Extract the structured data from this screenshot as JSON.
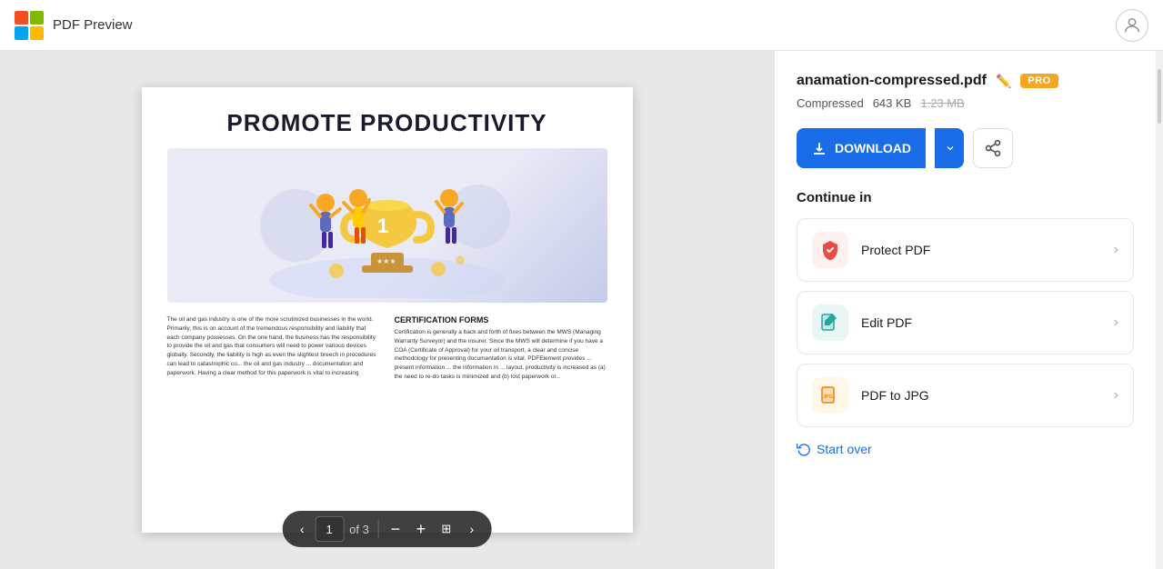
{
  "header": {
    "title": "PDF Preview",
    "logo_alt": "App logo"
  },
  "pdf": {
    "page_title": "PROMOTE PRODUCTIVITY",
    "body_left": "The oil and gas industry is one of the more scrutinized businesses in the world. Primarily, this is on account of the tremendous responsibility and liability that each company possesses. On the one hand, the business has the responsibility to provide the oil and gas that consumers will need to power various devices globally. Secondly, the liability is high as even the slightest breech in procedures can lead to catastrophic co... the oil and gas industry ... documentation and paperwork. Having a clear method for this paperwork is vital to increasing",
    "section_title": "CERTIFICATION FORMS",
    "body_right": "Certification is generally a back and forth of fixes between the MWS (Managing Warranty Surveyor) and the insurer. Since the MWS will determine if you have a COA (Certificate of Approval) for your oil transport, a clear and concise methodology for presenting documentation is vital. PDFElement provides ... present information ... the information in ... layout, productivity is increased as (a) the need to re-do tasks is minimized and (b) lost paperwork or..."
  },
  "pagination": {
    "current_page": "1",
    "of_label": "of 3",
    "prev_label": "‹",
    "next_label": "›",
    "fit_label": "⊞"
  },
  "sidebar": {
    "file_name": "anamation-compressed.pdf",
    "pro_badge": "PRO",
    "compressed_label": "Compressed",
    "file_size": "643 KB",
    "original_size": "1.23 MB",
    "download_label": "DOWNLOAD",
    "continue_label": "Continue in",
    "items": [
      {
        "id": "protect",
        "label": "Protect PDF",
        "icon": "🛡️",
        "icon_class": "icon-protect"
      },
      {
        "id": "edit",
        "label": "Edit PDF",
        "icon": "✏️",
        "icon_class": "icon-edit"
      },
      {
        "id": "jpg",
        "label": "PDF to JPG",
        "icon": "🖼️",
        "icon_class": "icon-jpg"
      }
    ],
    "start_over_label": "Start over"
  }
}
